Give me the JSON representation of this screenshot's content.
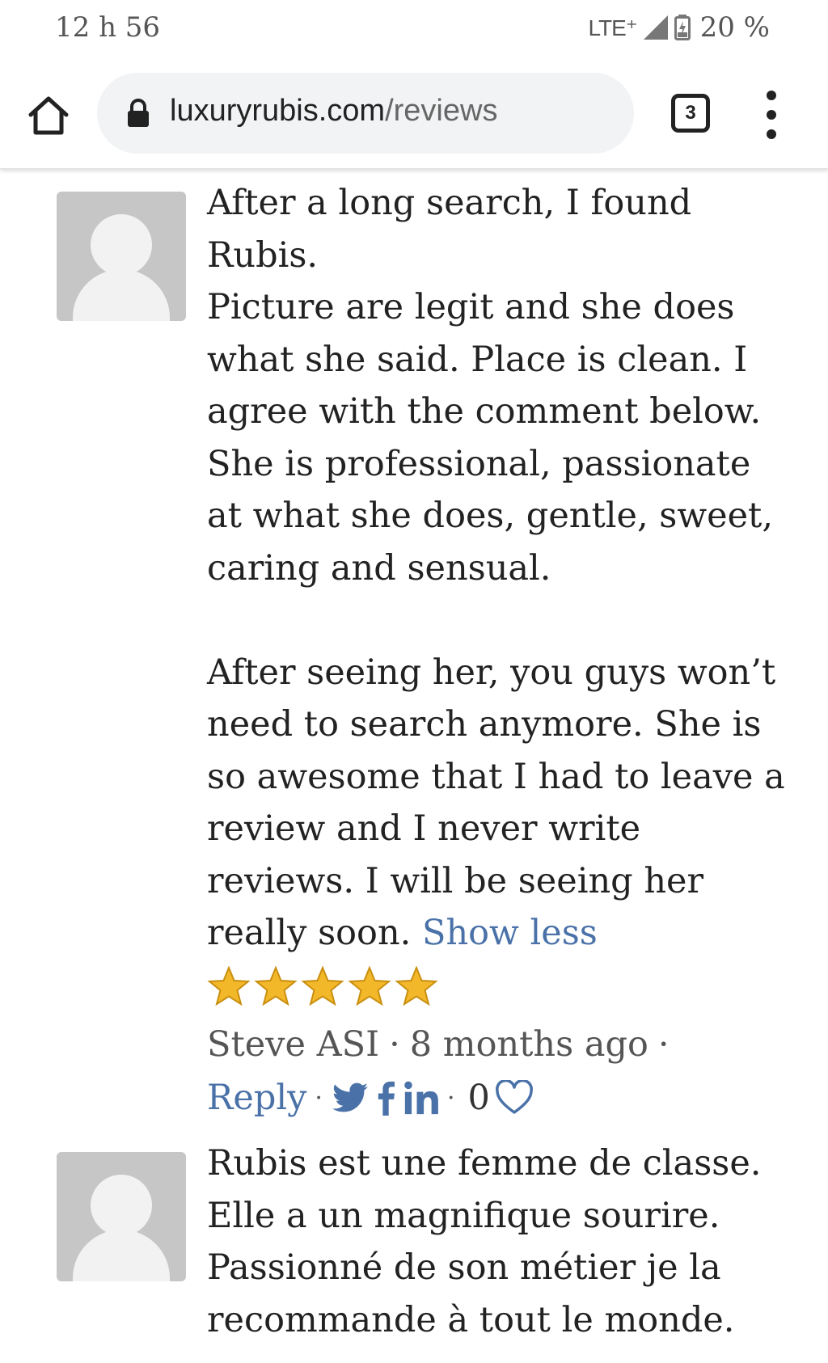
{
  "status_bar": {
    "time": "12 h 56",
    "network": "LTE⁺",
    "battery": "20 %"
  },
  "browser": {
    "url_domain": "luxuryrubis.com",
    "url_path": "/reviews",
    "tab_count": "3"
  },
  "reviews": [
    {
      "text_lines_p1": [
        "After a long search, I found",
        "Rubis.",
        "Picture are legit and she does",
        "what she said. Place is clean. I",
        "agree with the comment below.",
        "She is professional, passionate",
        "at what she does, gentle, sweet,",
        "caring and sensual."
      ],
      "text_lines_p2": [
        "After seeing her, you guys won’t",
        "need to search anymore. She is",
        "so awesome that I had to leave a",
        "review and I never write",
        "reviews. I will be seeing her"
      ],
      "last_line": "really soon.",
      "show_less": "Show less",
      "rating": 5,
      "author": "Steve ASI",
      "separator": "·",
      "age": "8 months ago",
      "reply": "Reply",
      "likes": "0"
    },
    {
      "text_lines": [
        "Rubis est une femme de classe.",
        "Elle a un magnifique sourire.",
        "Passionné de son métier je la",
        "recommande à tout le monde."
      ]
    }
  ],
  "colors": {
    "link": "#4a72a8",
    "star": "#f3b82a",
    "avatar_bg": "#c6c6c6"
  },
  "icons": [
    "home-icon",
    "lock-icon",
    "tabs-icon",
    "more-vert-icon",
    "star-icon",
    "twitter-icon",
    "facebook-icon",
    "linkedin-icon",
    "heart-icon"
  ]
}
